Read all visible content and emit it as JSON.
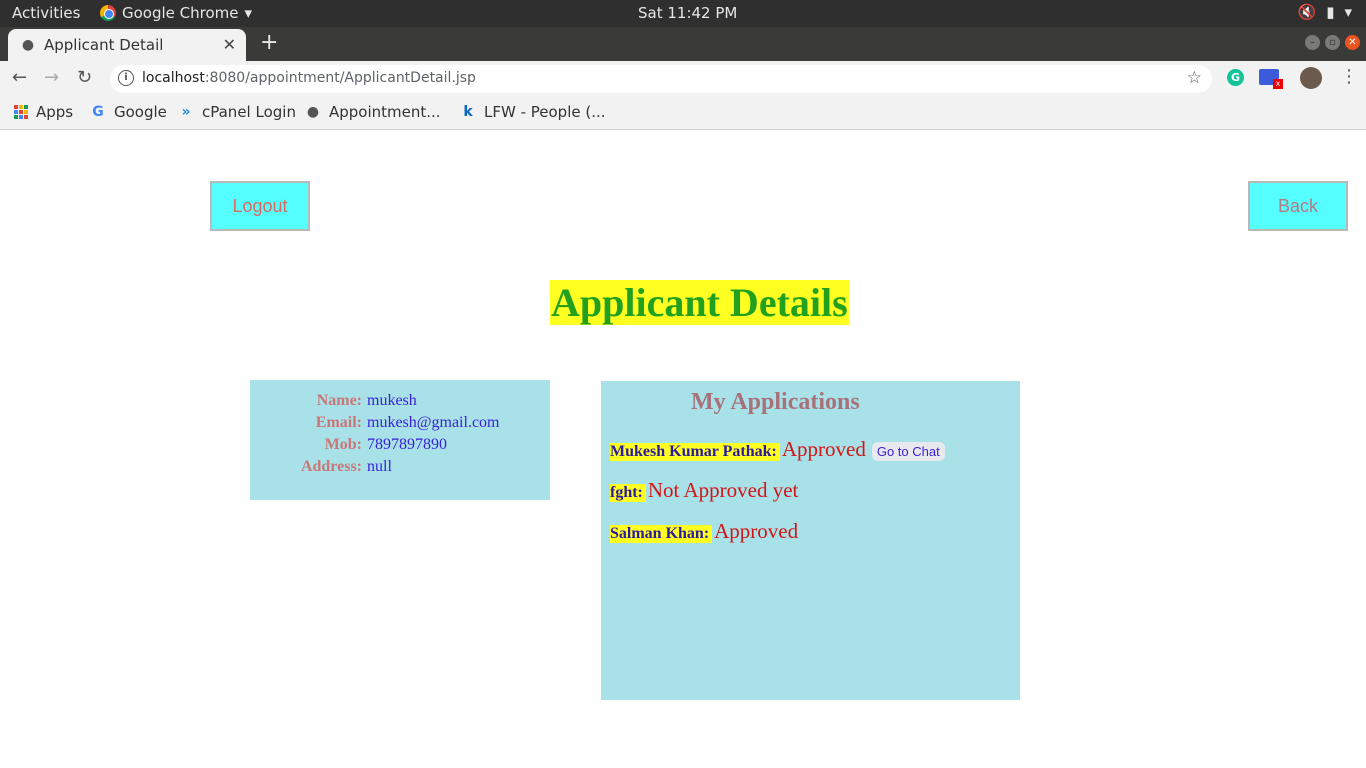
{
  "system": {
    "activities": "Activities",
    "app_name": "Google Chrome",
    "clock": "Sat 11:42 PM"
  },
  "browser": {
    "tab_title": "Applicant Detail",
    "url_host": "localhost",
    "url_rest": ":8080/appointment/ApplicantDetail.jsp",
    "bookmarks": [
      {
        "label": "Apps"
      },
      {
        "label": "Google"
      },
      {
        "label": "cPanel Login"
      },
      {
        "label": "Appointment..."
      },
      {
        "label": "LFW - People (..."
      }
    ]
  },
  "page": {
    "logout_label": "Logout",
    "back_label": "Back",
    "title": "Applicant Details",
    "details": [
      {
        "label": "Name:",
        "value": "mukesh"
      },
      {
        "label": "Email:",
        "value": "mukesh@gmail.com"
      },
      {
        "label": "Mob:",
        "value": "7897897890"
      },
      {
        "label": "Address:",
        "value": "null"
      }
    ],
    "applications_heading": "My Applications",
    "applications": [
      {
        "name": "Mukesh Kumar Pathak:",
        "status": "Approved",
        "chat_label": "Go to Chat"
      },
      {
        "name": "fght:",
        "status": "Not Approved yet"
      },
      {
        "name": "Salman Khan:",
        "status": "Approved"
      }
    ]
  },
  "colors": {
    "button_bg": "#55ffff",
    "title_bg": "#ffff22",
    "title_fg": "#22a11f",
    "panel_bg": "#a8e1e8",
    "status_fg": "#d31515"
  }
}
